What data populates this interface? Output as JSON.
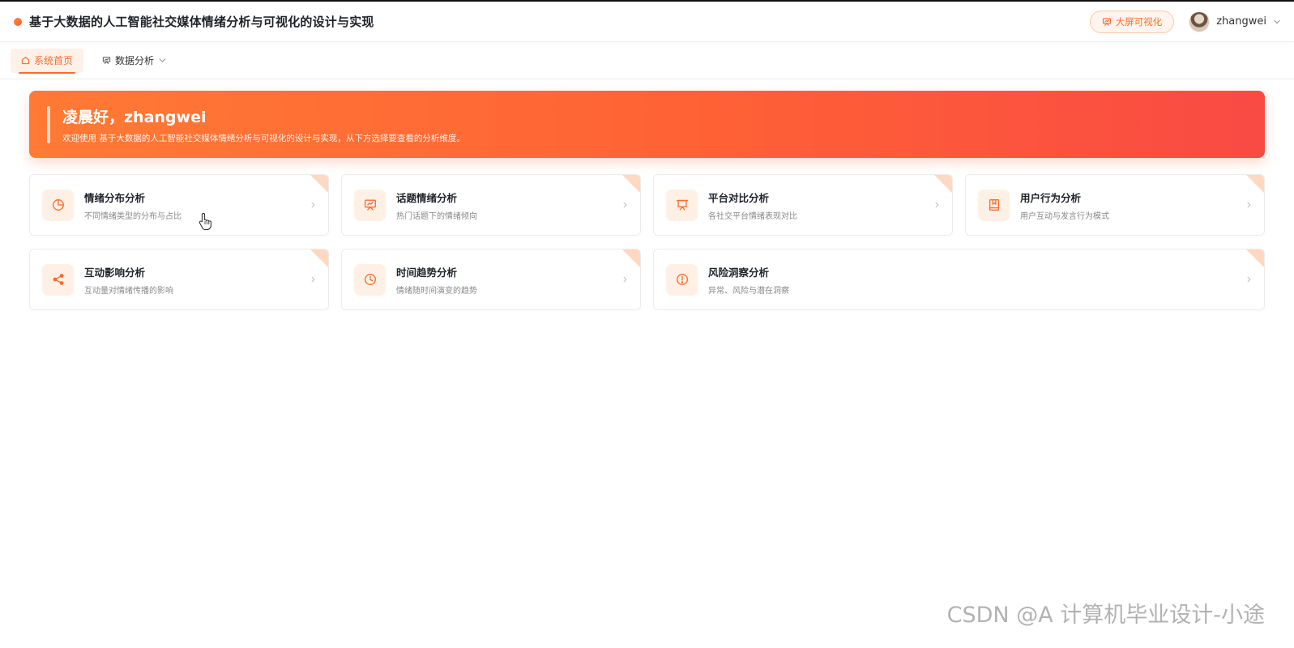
{
  "header": {
    "title": "基于大数据的人工智能社交媒体情绪分析与可视化的设计与实现",
    "big_screen_label": "大屏可视化",
    "username": "zhangwei"
  },
  "nav": {
    "tabs": [
      {
        "label": "系统首页",
        "icon": "home-icon",
        "active": true
      },
      {
        "label": "数据分析",
        "icon": "presentation-chart-icon",
        "active": false,
        "has_dropdown": true
      }
    ]
  },
  "banner": {
    "greeting": "凌晨好，zhangwei",
    "subtitle": "欢迎使用 基于大数据的人工智能社交媒体情绪分析与可视化的设计与实现，从下方选择要查看的分析维度。"
  },
  "cards": [
    {
      "title": "情绪分布分析",
      "desc": "不同情绪类型的分布与占比",
      "icon": "pie-chart-icon"
    },
    {
      "title": "话题情绪分析",
      "desc": "热门话题下的情绪倾向",
      "icon": "presentation-chart-icon"
    },
    {
      "title": "平台对比分析",
      "desc": "各社交平台情绪表现对比",
      "icon": "board-icon"
    },
    {
      "title": "用户行为分析",
      "desc": "用户互动与发言行为模式",
      "icon": "book-icon"
    },
    {
      "title": "互动影响分析",
      "desc": "互动量对情绪传播的影响",
      "icon": "share-icon"
    },
    {
      "title": "时间趋势分析",
      "desc": "情绪随时间演变的趋势",
      "icon": "clock-icon"
    },
    {
      "title": "风险洞察分析",
      "desc": "异常、风险与潜在洞察",
      "icon": "alert-icon"
    }
  ],
  "watermark": "CSDN @A 计算机毕业设计-小途",
  "colors": {
    "accent": "#ff6a2b",
    "banner_start": "#ff7a35",
    "banner_end": "#f94a44",
    "icon_bg": "#fff0e6"
  }
}
